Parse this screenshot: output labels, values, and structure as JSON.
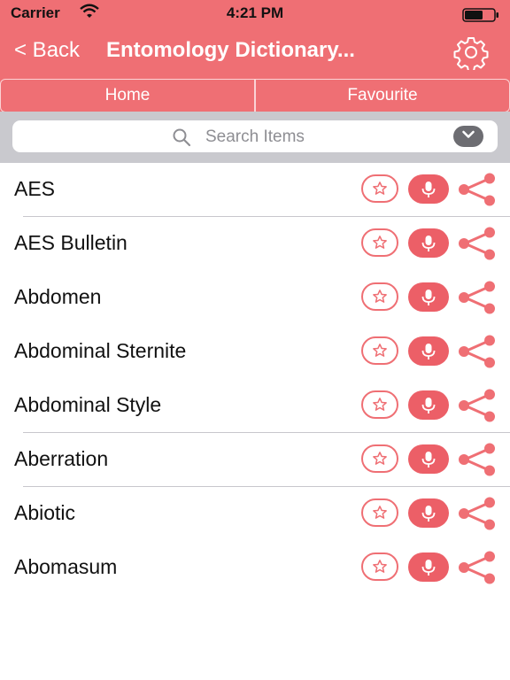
{
  "status_bar": {
    "carrier": "Carrier",
    "time": "4:21 PM"
  },
  "nav": {
    "back_label": "< Back",
    "title": "Entomology Dictionary..."
  },
  "tabs": [
    {
      "label": "Home"
    },
    {
      "label": "Favourite"
    }
  ],
  "search": {
    "placeholder": "Search Items",
    "value": ""
  },
  "items": [
    {
      "label": "AES"
    },
    {
      "label": "AES Bulletin"
    },
    {
      "label": "Abdomen"
    },
    {
      "label": "Abdominal Sternite"
    },
    {
      "label": "Abdominal Style"
    },
    {
      "label": "Aberration"
    },
    {
      "label": "Abiotic"
    },
    {
      "label": "Abomasum"
    }
  ],
  "icons": {
    "settings": "gear-icon",
    "favourite": "star-icon",
    "speak": "microphone-icon",
    "share": "share-icon",
    "search": "search-icon",
    "dropdown": "chevron-down-icon"
  },
  "colors": {
    "accent": "#ef6f74",
    "accent_dark": "#ec5f67",
    "search_bg": "#c9c9ce"
  }
}
